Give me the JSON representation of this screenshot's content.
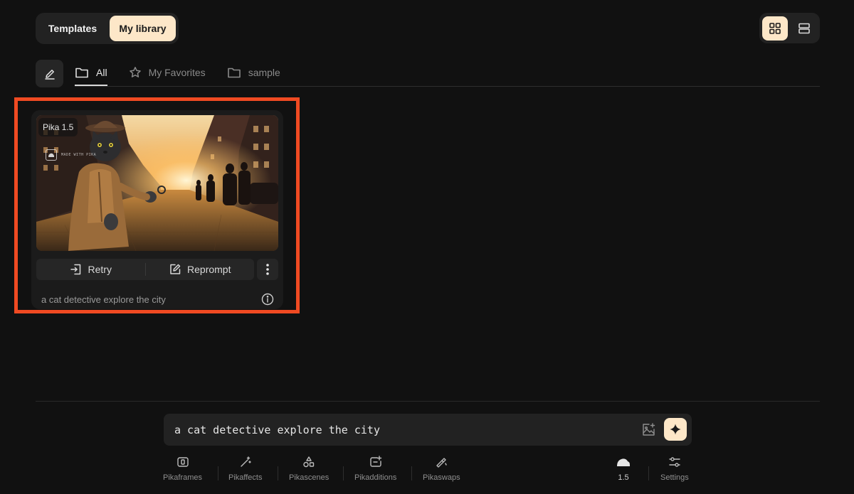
{
  "header": {
    "segments": [
      {
        "label": "Templates",
        "active": false
      },
      {
        "label": "My library",
        "active": true
      }
    ],
    "view_modes": [
      {
        "name": "grid",
        "active": true
      },
      {
        "name": "list",
        "active": false
      }
    ]
  },
  "folders": {
    "tabs": [
      {
        "label": "All",
        "icon": "folder-icon",
        "active": true
      },
      {
        "label": "My Favorites",
        "icon": "star-icon",
        "active": false
      },
      {
        "label": "sample",
        "icon": "folder-icon",
        "active": false
      }
    ]
  },
  "card": {
    "version_badge": "Pika 1.5",
    "watermark": "MADE WITH PIKA",
    "retry_label": "Retry",
    "reprompt_label": "Reprompt",
    "prompt": "a cat detective explore the city"
  },
  "prompt_bar": {
    "value": "a cat detective explore the city"
  },
  "toolbar": {
    "tools": [
      {
        "label": "Pikaframes",
        "icon": "pikaframes-icon"
      },
      {
        "label": "Pikaffects",
        "icon": "magic-wand-icon"
      },
      {
        "label": "Pikascenes",
        "icon": "shapes-icon"
      },
      {
        "label": "Pikadditions",
        "icon": "add-element-icon"
      },
      {
        "label": "Pikaswaps",
        "icon": "swap-brush-icon"
      }
    ],
    "model": "1.5",
    "settings": "Settings"
  },
  "colors": {
    "background": "#111111",
    "accent": "#fde7c8",
    "highlight_outline": "#f04a22"
  }
}
